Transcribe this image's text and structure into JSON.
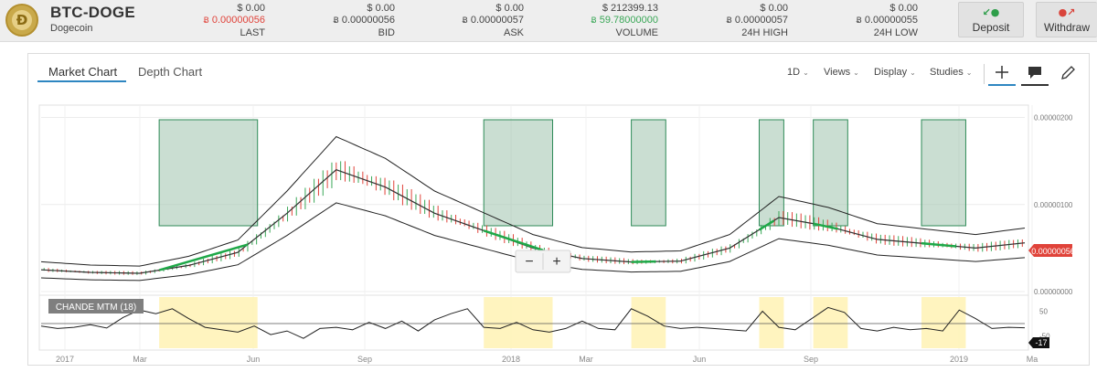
{
  "header": {
    "pair": "BTC-DOGE",
    "coin_name": "Dogecoin",
    "logo_glyph": "Ð",
    "btc_symbol": "Ƀ",
    "stats": [
      {
        "usd": "$ 0.00",
        "btc": "0.00000056",
        "label": "LAST",
        "tone": "red"
      },
      {
        "usd": "$ 0.00",
        "btc": "0.00000056",
        "label": "BID",
        "tone": "normal"
      },
      {
        "usd": "$ 0.00",
        "btc": "0.00000057",
        "label": "ASK",
        "tone": "normal"
      },
      {
        "usd": "$ 212399.13",
        "btc": "59.78000000",
        "label": "VOLUME",
        "tone": "green"
      },
      {
        "usd": "$ 0.00",
        "btc": "0.00000057",
        "label": "24H HIGH",
        "tone": "normal"
      },
      {
        "usd": "$ 0.00",
        "btc": "0.00000055",
        "label": "24H LOW",
        "tone": "normal"
      }
    ],
    "deposit_label": "Deposit",
    "withdraw_label": "Withdraw"
  },
  "chart_panel": {
    "tabs": [
      {
        "label": "Market Chart",
        "active": true
      },
      {
        "label": "Depth Chart",
        "active": false
      }
    ],
    "menus": [
      "1D",
      "Views",
      "Display",
      "Studies"
    ],
    "tools": [
      "crosshair-icon",
      "comment-icon",
      "pencil-icon"
    ],
    "zoom_out": "−",
    "zoom_in": "+",
    "indicator_label": "CHANDE MTM (18)",
    "price_axis": [
      "0.00000200",
      "0.00000100",
      "0.00000000"
    ],
    "osc_axis": [
      "50",
      "-50"
    ],
    "current_price_tag": "0.00000056",
    "current_osc_tag": "-17",
    "time_axis": [
      "2017",
      "Mar",
      "Jun",
      "Sep",
      "2018",
      "Mar",
      "Jun",
      "Sep",
      "2019",
      "Ma"
    ]
  },
  "colors": {
    "accent": "#2e86c1",
    "up": "#3aa757",
    "down": "#e0433a",
    "highlight_box": "#9fc3ad",
    "osc_highlight": "#fff3b8"
  },
  "chart_data": {
    "type": "line",
    "x_ticks": [
      "2017",
      "Mar",
      "Jun",
      "Sep",
      "2018",
      "Mar",
      "Jun",
      "Sep",
      "2019",
      "Ma"
    ],
    "y_ticks": [
      2e-06,
      1e-06,
      0.0
    ],
    "ylim": [
      0,
      2.1e-06
    ],
    "x": [
      0,
      5,
      10,
      15,
      20,
      25,
      30,
      35,
      40,
      45,
      50,
      55,
      60,
      65,
      70,
      75,
      80,
      85,
      90,
      95,
      100
    ],
    "series": [
      {
        "values": [
          2.5e-07,
          2.2e-07,
          2.1e-07,
          3e-07,
          4.5e-07,
          9e-07,
          1.4e-06,
          1.2e-06,
          9e-07,
          7e-07,
          5e-07,
          3.8e-07,
          3.4e-07,
          3.5e-07,
          5e-07,
          8.5e-07,
          7.5e-07,
          6e-07,
          5.5e-07,
          5e-07,
          5.6e-07
        ]
      }
    ],
    "oscillator": {
      "name": "CHANDE MTM (18)",
      "ylim": [
        -100,
        100
      ],
      "values": [
        -10,
        -20,
        -15,
        -5,
        -18,
        25,
        55,
        40,
        60,
        20,
        -15,
        -25,
        -35,
        -10,
        -45,
        -30,
        -60,
        -20,
        -15,
        -25,
        5,
        -20,
        10,
        -30,
        15,
        40,
        60,
        -15,
        -20,
        5,
        -25,
        -35,
        -20,
        10,
        -20,
        -25,
        60,
        30,
        -10,
        -20,
        -15,
        -20,
        -25,
        -30,
        50,
        -15,
        -25,
        20,
        65,
        45,
        -20,
        -30,
        -15,
        -25,
        -20,
        -30,
        55,
        20,
        -20,
        -15,
        -17
      ]
    },
    "annotations": "shaded rectangles mark rising phases on both panes"
  }
}
